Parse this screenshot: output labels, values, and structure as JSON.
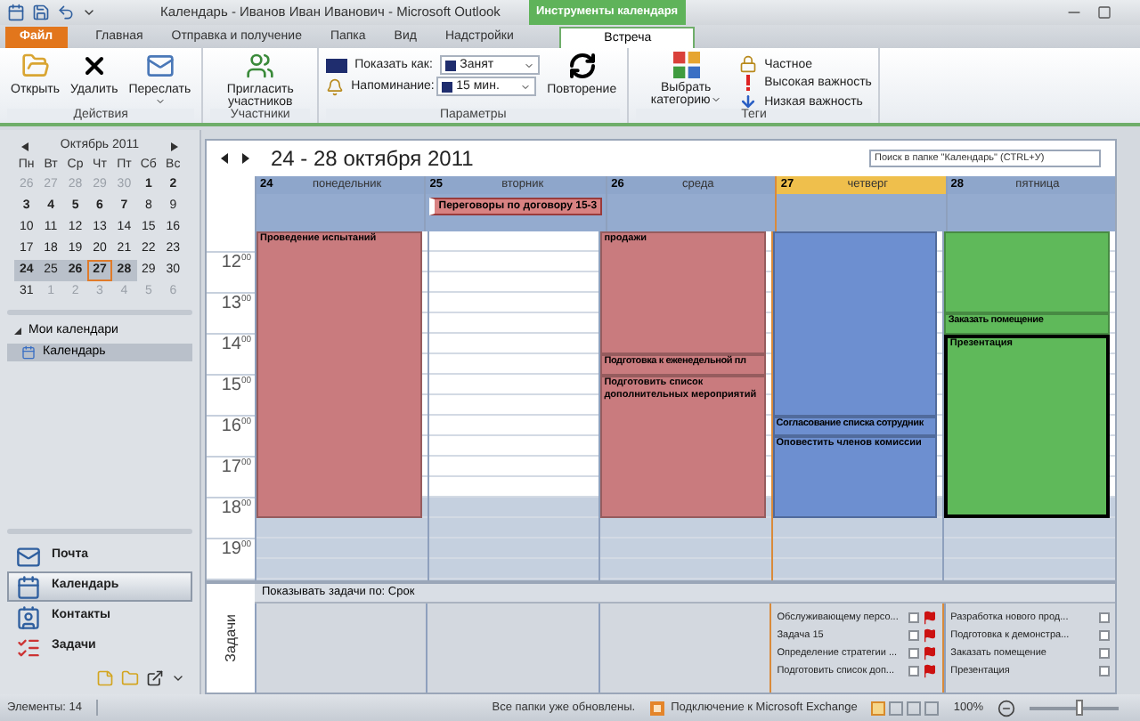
{
  "window": {
    "title": "Календарь - Иванов Иван Иванович - Microsoft Outlook",
    "contextual_group": "Инструменты календаря"
  },
  "tabs": [
    {
      "label": "Файл",
      "kind": "file",
      "selected": false
    },
    {
      "label": "Главная",
      "kind": "normal",
      "selected": false
    },
    {
      "label": "Отправка и получение",
      "kind": "normal",
      "selected": false
    },
    {
      "label": "Папка",
      "kind": "normal",
      "selected": false
    },
    {
      "label": "Вид",
      "kind": "normal",
      "selected": false
    },
    {
      "label": "Надстройки",
      "kind": "normal",
      "selected": false
    },
    {
      "label": "Встреча",
      "kind": "contextual",
      "selected": true
    }
  ],
  "ribbon": {
    "groups": [
      {
        "label": "Действия",
        "items": [
          {
            "kind": "large",
            "label": "Открыть",
            "dropdown": false
          },
          {
            "kind": "large",
            "label": "Удалить",
            "dropdown": false
          },
          {
            "kind": "large",
            "label": "Переслать",
            "dropdown": true
          }
        ]
      },
      {
        "label": "Участники",
        "items": [
          {
            "kind": "large",
            "label": "Пригласить участников",
            "dropdown": false
          }
        ]
      },
      {
        "label": "Параметры",
        "items": [
          {
            "kind": "stack",
            "rows": [
              {
                "kind": "field",
                "label": "Показать как:",
                "value": "Занят"
              },
              {
                "kind": "field",
                "label": "Напоминание:",
                "value": "15 мин."
              }
            ]
          },
          {
            "kind": "large",
            "label": "Повторение",
            "dropdown": false
          }
        ]
      },
      {
        "label": "Теги",
        "items": [
          {
            "kind": "large",
            "label": "Выбрать категорию",
            "dropdown": true
          },
          {
            "kind": "stack",
            "rows": [
              {
                "kind": "small",
                "label": "Частное"
              },
              {
                "kind": "small",
                "label": "Высокая важность"
              },
              {
                "kind": "small",
                "label": "Низкая важность"
              }
            ]
          }
        ]
      }
    ]
  },
  "mini_calendar": {
    "title": "Октябрь 2011",
    "weekdays": [
      "Пн",
      "Вт",
      "Ср",
      "Чт",
      "Пт",
      "Сб",
      "Вс"
    ],
    "weeks": [
      [
        {
          "d": "26",
          "kind": "other",
          "selected": false,
          "today": false
        },
        {
          "d": "27",
          "kind": "other",
          "selected": false,
          "today": false
        },
        {
          "d": "28",
          "kind": "other",
          "selected": false,
          "today": false
        },
        {
          "d": "29",
          "kind": "other",
          "selected": false,
          "today": false
        },
        {
          "d": "30",
          "kind": "other",
          "selected": false,
          "today": false
        },
        {
          "d": "1",
          "kind": "bold",
          "selected": false,
          "today": false
        },
        {
          "d": "2",
          "kind": "bold",
          "selected": false,
          "today": false
        }
      ],
      [
        {
          "d": "3",
          "kind": "bold",
          "selected": false,
          "today": false
        },
        {
          "d": "4",
          "kind": "bold",
          "selected": false,
          "today": false
        },
        {
          "d": "5",
          "kind": "bold",
          "selected": false,
          "today": false
        },
        {
          "d": "6",
          "kind": "bold",
          "selected": false,
          "today": false
        },
        {
          "d": "7",
          "kind": "bold",
          "selected": false,
          "today": false
        },
        {
          "d": "8",
          "kind": "normal",
          "selected": false,
          "today": false
        },
        {
          "d": "9",
          "kind": "normal",
          "selected": false,
          "today": false
        }
      ],
      [
        {
          "d": "10",
          "kind": "normal",
          "selected": false,
          "today": false
        },
        {
          "d": "11",
          "kind": "normal",
          "selected": false,
          "today": false
        },
        {
          "d": "12",
          "kind": "normal",
          "selected": false,
          "today": false
        },
        {
          "d": "13",
          "kind": "normal",
          "selected": false,
          "today": false
        },
        {
          "d": "14",
          "kind": "normal",
          "selected": false,
          "today": false
        },
        {
          "d": "15",
          "kind": "normal",
          "selected": false,
          "today": false
        },
        {
          "d": "16",
          "kind": "normal",
          "selected": false,
          "today": false
        }
      ],
      [
        {
          "d": "17",
          "kind": "normal",
          "selected": false,
          "today": false
        },
        {
          "d": "18",
          "kind": "normal",
          "selected": false,
          "today": false
        },
        {
          "d": "19",
          "kind": "normal",
          "selected": false,
          "today": false
        },
        {
          "d": "20",
          "kind": "normal",
          "selected": false,
          "today": false
        },
        {
          "d": "21",
          "kind": "normal",
          "selected": false,
          "today": false
        },
        {
          "d": "22",
          "kind": "normal",
          "selected": false,
          "today": false
        },
        {
          "d": "23",
          "kind": "normal",
          "selected": false,
          "today": false
        }
      ],
      [
        {
          "d": "24",
          "kind": "bold",
          "selected": true,
          "today": false
        },
        {
          "d": "25",
          "kind": "normal",
          "selected": true,
          "today": false
        },
        {
          "d": "26",
          "kind": "bold",
          "selected": true,
          "today": false
        },
        {
          "d": "27",
          "kind": "bold",
          "selected": true,
          "today": true
        },
        {
          "d": "28",
          "kind": "bold",
          "selected": true,
          "today": false
        },
        {
          "d": "29",
          "kind": "normal",
          "selected": false,
          "today": false
        },
        {
          "d": "30",
          "kind": "normal",
          "selected": false,
          "today": false
        }
      ],
      [
        {
          "d": "31",
          "kind": "normal",
          "selected": false,
          "today": false
        },
        {
          "d": "1",
          "kind": "other",
          "selected": false,
          "today": false
        },
        {
          "d": "2",
          "kind": "other",
          "selected": false,
          "today": false
        },
        {
          "d": "3",
          "kind": "other",
          "selected": false,
          "today": false
        },
        {
          "d": "4",
          "kind": "other",
          "selected": false,
          "today": false
        },
        {
          "d": "5",
          "kind": "other",
          "selected": false,
          "today": false
        },
        {
          "d": "6",
          "kind": "other",
          "selected": false,
          "today": false
        }
      ]
    ]
  },
  "calendars": {
    "label": "Мои календари",
    "expanded": true,
    "children": [
      {
        "label": "Календарь",
        "selected": true
      }
    ]
  },
  "nav": [
    {
      "label": "Почта",
      "selected": false
    },
    {
      "label": "Календарь",
      "selected": true
    },
    {
      "label": "Контакты",
      "selected": false
    },
    {
      "label": "Задачи",
      "selected": false
    }
  ],
  "calendar": {
    "title": "24 - 28 октября 2011",
    "search": {
      "placeholder": "Поиск в папке \"Календарь\" (CTRL+У)"
    },
    "hours": [
      {
        "h": "12",
        "m": "00"
      },
      {
        "h": "13",
        "m": "00"
      },
      {
        "h": "14",
        "m": "00"
      },
      {
        "h": "15",
        "m": "00"
      },
      {
        "h": "16",
        "m": "00"
      },
      {
        "h": "17",
        "m": "00"
      },
      {
        "h": "18",
        "m": "00"
      },
      {
        "h": "19",
        "m": "00"
      }
    ],
    "days": [
      {
        "date": "24",
        "weekday": "понедельник",
        "today": false,
        "events": [
          {
            "title": "Проведение испытаний",
            "color": "#c97b7e",
            "selected": false
          }
        ]
      },
      {
        "date": "25",
        "weekday": "вторник",
        "today": false,
        "all_day": [
          {
            "title": "Переговоры по договору 15-3",
            "color": "#d88282"
          }
        ]
      },
      {
        "date": "26",
        "weekday": "среда",
        "today": false,
        "events": [
          {
            "title": "продажи",
            "color": "#c97b7e",
            "selected": false
          },
          {
            "title": "Подготовка к еженедельной пл",
            "color": "#c97b7e",
            "selected": false
          },
          {
            "title": "Подготовить список дополнительных мероприятий",
            "color": "#c97b7e",
            "selected": false
          }
        ]
      },
      {
        "date": "27",
        "weekday": "четверг",
        "today": true,
        "events": [
          {
            "color": "#6d8fd0",
            "selected": false
          },
          {
            "title": "Согласование списка сотрудник",
            "color": "#6d8fd0",
            "selected": false
          },
          {
            "title": "Оповестить членов комиссии",
            "color": "#6d8fd0",
            "selected": false
          }
        ],
        "tasks": [
          {
            "title": "Обслуживающему персо...",
            "checked": false,
            "flagged": true
          },
          {
            "title": "Задача 15",
            "checked": false,
            "flagged": true
          },
          {
            "title": "Определение стратегии ...",
            "checked": false,
            "flagged": true
          },
          {
            "title": "Подготовить список доп...",
            "checked": false,
            "flagged": true
          }
        ]
      },
      {
        "date": "28",
        "weekday": "пятница",
        "today": false,
        "events": [
          {
            "color": "#5fb95a",
            "selected": false
          },
          {
            "title": "Заказать помещение",
            "color": "#5fb95a",
            "selected": false
          },
          {
            "title": "Презентация",
            "color": "#5fb95a",
            "selected": true
          }
        ],
        "tasks": [
          {
            "title": "Разработка нового прод...",
            "checked": false,
            "flagged": false
          },
          {
            "title": "Подготовка к демонстра...",
            "checked": false,
            "flagged": false
          },
          {
            "title": "Заказать помещение",
            "checked": false,
            "flagged": false
          },
          {
            "title": "Презентация",
            "checked": false,
            "flagged": false
          }
        ]
      }
    ],
    "tasks_label": "Задачи",
    "tasks_header": "Показывать задачи по: Срок"
  },
  "status_bar": {
    "items_count": "Элементы: 14",
    "sync": "Все папки уже обновлены.",
    "connection": "Подключение к Microsoft Exchange",
    "zoom": {
      "reading": "100%",
      "level": 0.55
    }
  }
}
